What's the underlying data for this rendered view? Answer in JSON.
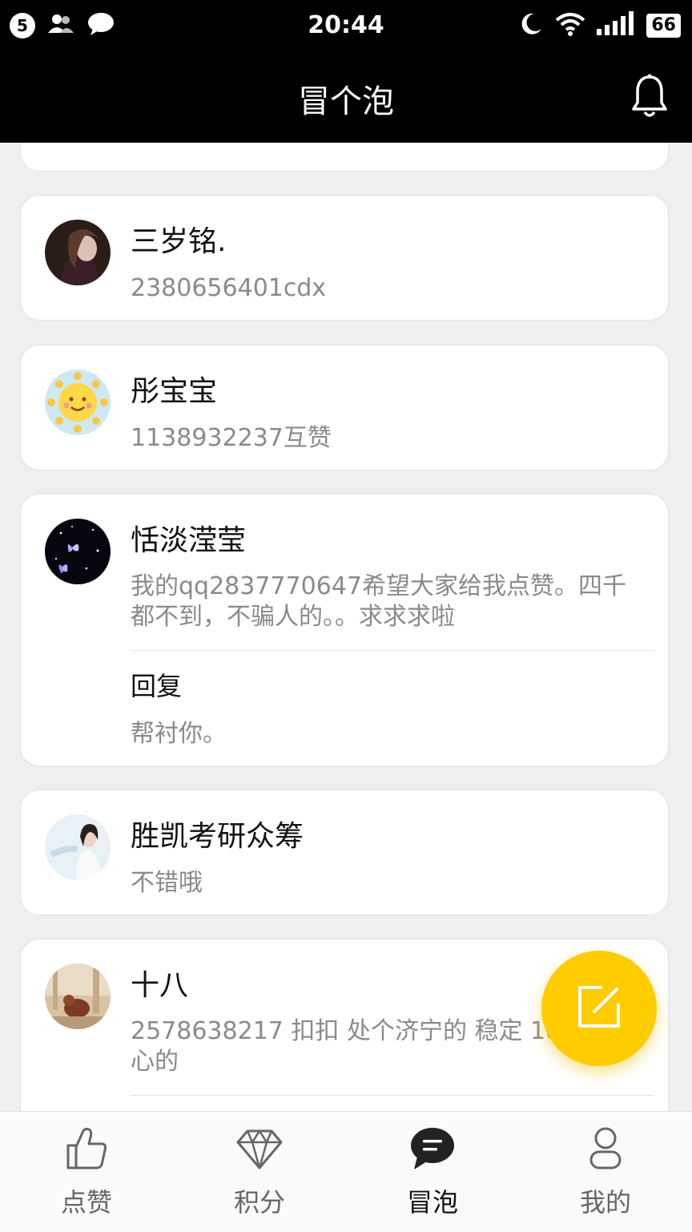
{
  "status_bar": {
    "notification_count": "5",
    "time": "20:44",
    "battery": "66"
  },
  "header": {
    "title": "冒个泡"
  },
  "posts": [
    {
      "name": "三岁铭.",
      "message": "2380656401cdx"
    },
    {
      "name": "彤宝宝",
      "message": "1138932237互赞"
    },
    {
      "name": "恬淡滢莹",
      "message": "我的qq2837770647希望大家给我点赞。四千都不到，不骗人的。。求求求啦",
      "reply_label": "回复",
      "reply_text": "帮衬你。"
    },
    {
      "name": "胜凯考研众筹",
      "message": "不错哦"
    },
    {
      "name": "十八",
      "message": "2578638217   扣扣 处个济宁的 稳定 18周岁 真心的"
    }
  ],
  "bottom_nav": [
    {
      "label": "点赞",
      "icon": "thumbs-up-icon"
    },
    {
      "label": "积分",
      "icon": "diamond-icon"
    },
    {
      "label": "冒泡",
      "icon": "chat-bubble-icon",
      "active": true
    },
    {
      "label": "我的",
      "icon": "user-icon"
    }
  ],
  "colors": {
    "accent": "#ffcc00",
    "header_bg": "#000000",
    "page_bg": "#efefef"
  }
}
